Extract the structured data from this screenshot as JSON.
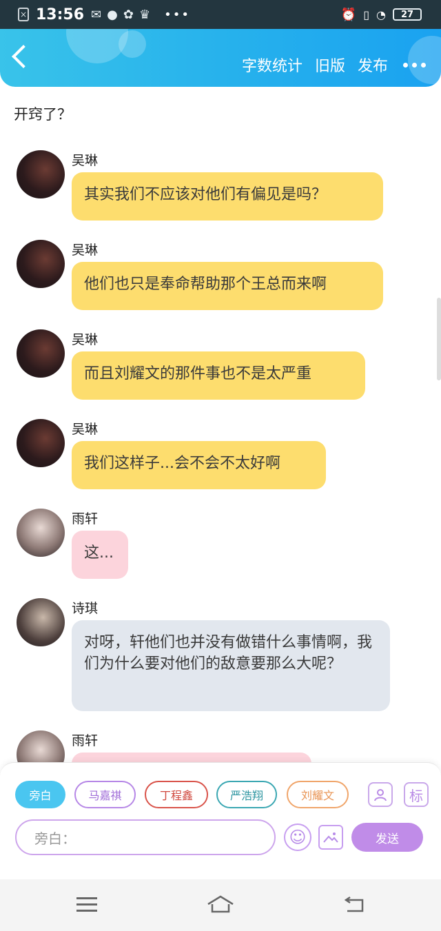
{
  "status_bar": {
    "time": "13:56",
    "battery": "27",
    "icons": [
      "close-notification-icon",
      "wechat-icon",
      "planet-icon",
      "pinwheel-icon",
      "crown-icon",
      "more-dots-icon",
      "alarm-icon",
      "vibrate-icon",
      "wifi-icon",
      "battery-icon"
    ]
  },
  "header": {
    "actions": {
      "word_count": "字数统计",
      "old_version": "旧版",
      "publish": "发布"
    }
  },
  "intro_text": "开窍了？",
  "messages": [
    {
      "sender": "吴琳",
      "text": "其实我们不应该对他们有偏见是吗？",
      "color": "#fddd6e"
    },
    {
      "sender": "吴琳",
      "text": "他们也只是奉命帮助那个王总而来啊",
      "color": "#fddd6e"
    },
    {
      "sender": "吴琳",
      "text": "而且刘耀文的那件事也不是太严重",
      "color": "#fddd6e"
    },
    {
      "sender": "吴琳",
      "text": "我们这样子...会不会不太好啊",
      "color": "#fddd6e"
    },
    {
      "sender": "雨轩",
      "text": "这...",
      "color": "#fcd4dc"
    },
    {
      "sender": "诗琪",
      "text": "对呀，轩他们也并没有做错什么事情啊，我们为什么要对他们的敌意要那么大呢？",
      "color": "#e2e7ee"
    },
    {
      "sender": "雨轩",
      "text": "",
      "color": "#fcd4dc"
    }
  ],
  "composer": {
    "roles": [
      "旁白",
      "马嘉祺",
      "丁程鑫",
      "严浩翔",
      "刘耀文"
    ],
    "role_colors": [
      "#4ac6f0",
      "#b687e6",
      "#d9534a",
      "#3aa7b2",
      "#f0a56a"
    ],
    "mark_label": "标",
    "input_placeholder": "旁白：",
    "send_label": "发送"
  }
}
